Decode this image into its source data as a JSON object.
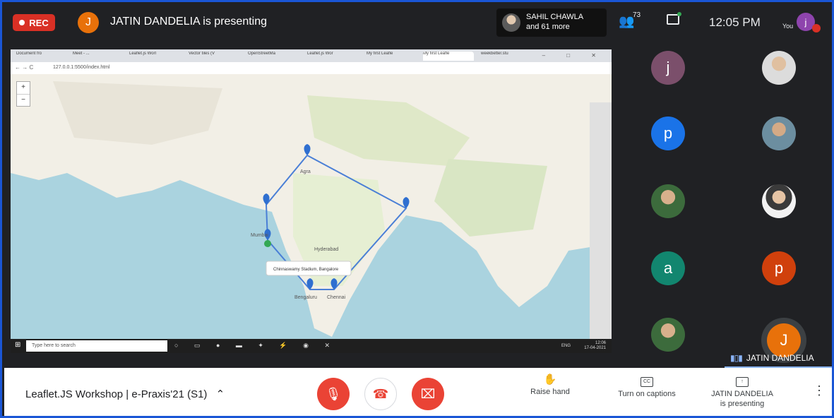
{
  "top": {
    "rec_label": "REC",
    "presenter_initial": "J",
    "presenting_title": "JATIN DANDELIA is presenting",
    "speaker_name": "SAHIL CHAWLA",
    "speaker_more": "and 61 more",
    "people_count": "73",
    "time": "12:05 PM",
    "you_label": "You",
    "you_initial": "j"
  },
  "browser": {
    "tabs": [
      "Document fro",
      "Meet - ...",
      "Leaflet.js Worl",
      "Vector tiles (V",
      "OpenStreetMa",
      "Leaflet.js Wor",
      "My first Leafle",
      "My first Leafle",
      "weekbetter.stu"
    ],
    "url": "127.0.0.1:5500/index.html",
    "popup_text": "Chinnaswamy Stadium, Bangalore",
    "taskbar_search": "Type here to search",
    "tray_time": "12:06",
    "tray_date": "17-04-2021",
    "tray_lang": "ENG"
  },
  "map": {
    "labels": [
      "Mumbai",
      "Agra",
      "Chennai",
      "Bengaluru",
      "Hyderabad"
    ],
    "route_color": "#4a7fd6",
    "marker_color": "#2f6fd0"
  },
  "participants": [
    {
      "initial": "j",
      "color": "#7b4f6b"
    },
    {
      "initial": "",
      "color": "photo"
    },
    {
      "initial": "p",
      "color": "#1a73e8"
    },
    {
      "initial": "",
      "color": "photo"
    },
    {
      "initial": "",
      "color": "photo"
    },
    {
      "initial": "",
      "color": "photo"
    },
    {
      "initial": "a",
      "color": "#12866f"
    },
    {
      "initial": "p",
      "color": "#d0400c"
    },
    {
      "initial": "",
      "color": "photo"
    },
    {
      "initial": "J",
      "color": "#e8710a"
    }
  ],
  "active_speaker": "JATIN DANDELIA",
  "bottom": {
    "meeting_title": "Leaflet.JS Workshop | e-Praxis'21 (S1)",
    "raise_hand": "Raise hand",
    "captions": "Turn on captions",
    "presenting_line1": "JATIN DANDELIA",
    "presenting_line2": "is presenting"
  }
}
